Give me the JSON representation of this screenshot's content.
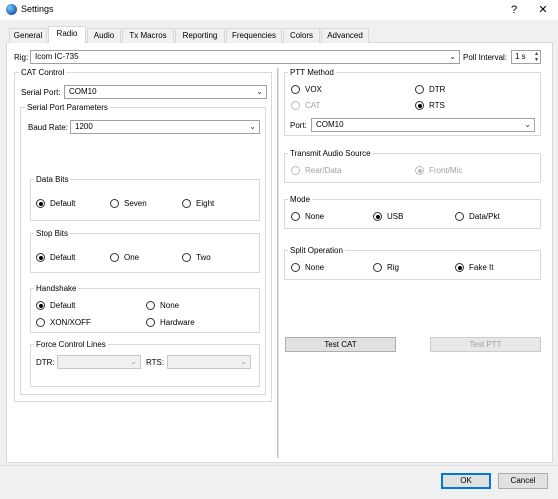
{
  "window": {
    "title": "Settings",
    "help_glyph": "?",
    "close_glyph": "✕"
  },
  "tabs": [
    "General",
    "Radio",
    "Audio",
    "Tx Macros",
    "Reporting",
    "Frequencies",
    "Colors",
    "Advanced"
  ],
  "active_tab": "Radio",
  "rig": {
    "label": "Rig:",
    "value": "Icom IC-735",
    "poll_label": "Poll Interval:",
    "poll_value": "1 s"
  },
  "cat": {
    "title": "CAT Control",
    "serial_port_label": "Serial Port:",
    "serial_port_value": "COM10",
    "spp_title": "Serial Port Parameters",
    "baud_label": "Baud Rate:",
    "baud_value": "1200",
    "data_bits": {
      "title": "Data Bits",
      "options": [
        "Default",
        "Seven",
        "Eight"
      ],
      "selected": "Default"
    },
    "stop_bits": {
      "title": "Stop Bits",
      "options": [
        "Default",
        "One",
        "Two"
      ],
      "selected": "Default"
    },
    "handshake": {
      "title": "Handshake",
      "options": [
        "Default",
        "None",
        "XON/XOFF",
        "Hardware"
      ],
      "selected": "Default"
    },
    "force": {
      "title": "Force Control Lines",
      "dtr_label": "DTR:",
      "dtr_value": "",
      "rts_label": "RTS:",
      "rts_value": ""
    }
  },
  "ptt": {
    "title": "PTT Method",
    "options": [
      "VOX",
      "DTR",
      "CAT",
      "RTS"
    ],
    "selected": "RTS",
    "disabled": [
      "CAT"
    ],
    "port_label": "Port:",
    "port_value": "COM10"
  },
  "audio_source": {
    "title": "Transmit Audio Source",
    "options": [
      "Rear/Data",
      "Front/Mic"
    ],
    "selected": "Front/Mic"
  },
  "mode": {
    "title": "Mode",
    "options": [
      "None",
      "USB",
      "Data/Pkt"
    ],
    "selected": "USB"
  },
  "split": {
    "title": "Split Operation",
    "options": [
      "None",
      "Rig",
      "Fake It"
    ],
    "selected": "Fake It"
  },
  "buttons": {
    "test_cat": "Test CAT",
    "test_ptt": "Test PTT",
    "ok": "OK",
    "cancel": "Cancel"
  },
  "icons": {
    "app": "globe-icon",
    "dropdown": "chevron-down-icon",
    "help": "help-icon",
    "close": "close-icon"
  }
}
